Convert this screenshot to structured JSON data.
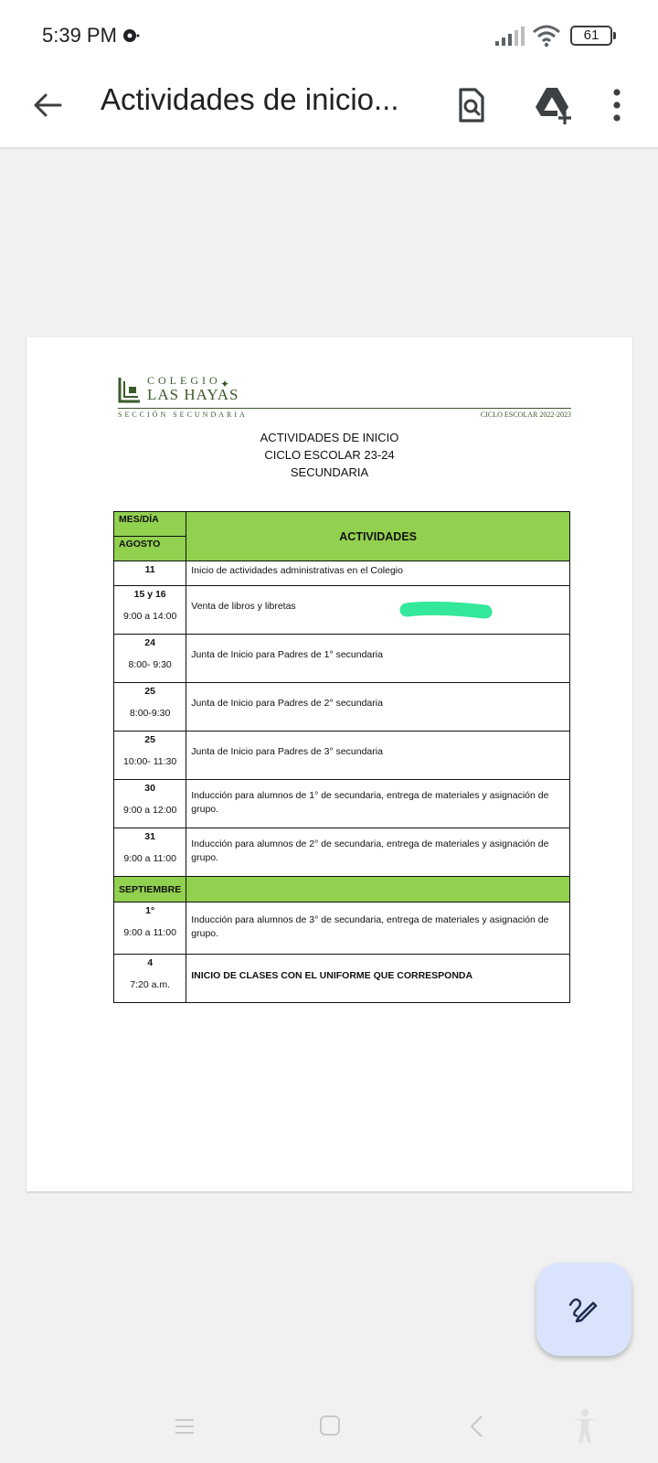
{
  "status": {
    "time": "5:39 PM",
    "battery": "61"
  },
  "appbar": {
    "title": "Actividades de inicio..."
  },
  "document": {
    "logo": {
      "colegio": "COLEGIO",
      "name": "LAS HAYAS",
      "section": "SECCIÓN SECUNDARIA",
      "cycle": "CICLO ESCOLAR 2022-2023"
    },
    "heading": [
      "ACTIVIDADES DE INICIO",
      "CICLO ESCOLAR 23-24",
      "SECUNDARIA"
    ],
    "table": {
      "col1_header": "MES/DÍA",
      "month1": "AGOSTO",
      "col2_header": "ACTIVIDADES",
      "month2": "SEPTIEMBRE",
      "rows": [
        {
          "day": "11",
          "time": "",
          "activity": "Inicio de actividades administrativas en el Colegio"
        },
        {
          "day": "15 y 16",
          "time": "9:00 a 14:00",
          "activity": "Venta de libros y libretas"
        },
        {
          "day": "24",
          "time": "8:00- 9:30",
          "activity": "Junta de Inicio para Padres de 1° secundaria"
        },
        {
          "day": "25",
          "time": "8:00-9:30",
          "activity": "Junta de Inicio para Padres de 2° secundaria"
        },
        {
          "day": "25",
          "time": "10:00- 11:30",
          "activity": "Junta de Inicio para Padres de 3° secundaria"
        },
        {
          "day": "30",
          "time": "9:00 a 12:00",
          "activity": "Inducción para alumnos de 1° de secundaria, entrega de materiales y asignación de grupo."
        },
        {
          "day": "31",
          "time": "9:00 a 11:00",
          "activity": "Inducción para alumnos de 2° de secundaria, entrega de materiales y asignación de grupo."
        },
        {
          "day": "1°",
          "time": "9:00 a 11:00",
          "activity": "Inducción para alumnos de 3° de secundaria, entrega de materiales y asignación de grupo."
        },
        {
          "day": "4",
          "time": "7:20 a.m.",
          "activity": "INICIO DE CLASES CON EL UNIFORME QUE CORRESPONDA"
        }
      ]
    }
  },
  "colors": {
    "table_header_green": "#92d050",
    "highlight_mark": "#33e89a",
    "fab_background": "#d9e3fb",
    "logo_green": "#3b5a2a"
  },
  "icons": {
    "back": "arrow-back-icon",
    "search_doc": "find-in-document-icon",
    "drive_add": "add-to-drive-icon",
    "more": "more-vert-icon",
    "fab": "edit-pen-icon"
  }
}
